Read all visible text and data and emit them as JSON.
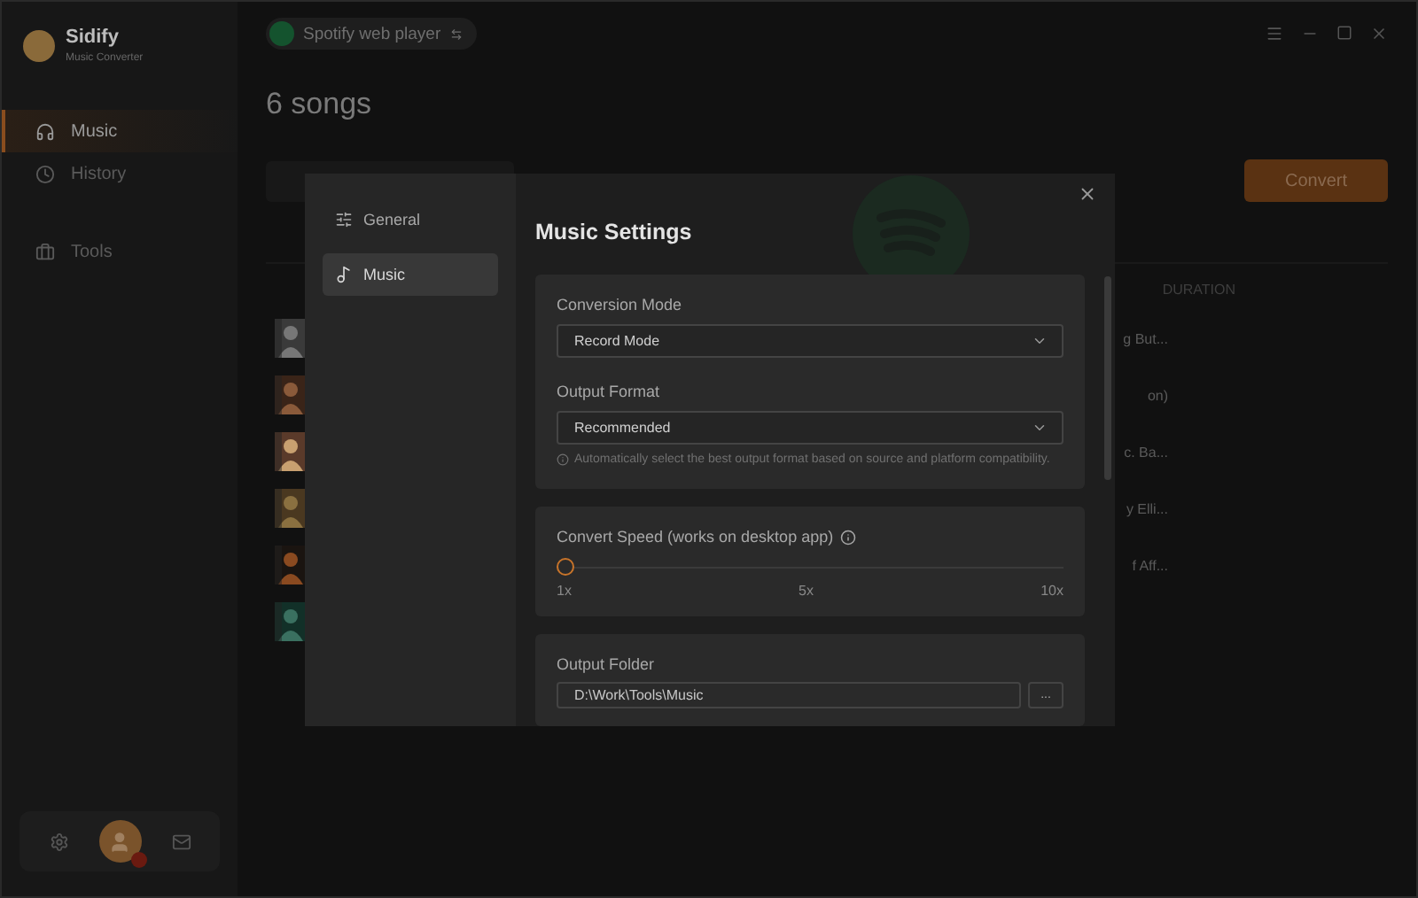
{
  "app": {
    "name": "Sidify",
    "subtitle": "Music Converter"
  },
  "sidebar": {
    "items": [
      {
        "label": "Music",
        "selected": true
      },
      {
        "label": "History",
        "selected": false
      },
      {
        "label": "Tools",
        "selected": false
      }
    ]
  },
  "source": {
    "label": "Spotify web player"
  },
  "page": {
    "title": "6 songs",
    "convert_button": "Convert",
    "duration_header": "DURATION"
  },
  "tracks": [
    {
      "kind": "picture",
      "title_tail": "g But..."
    },
    {
      "kind": "picture",
      "title_tail": "on)"
    },
    {
      "kind": "picture",
      "title_tail": "c. Ba..."
    },
    {
      "kind": "picture",
      "title_tail": "y Elli..."
    },
    {
      "kind": "picture",
      "title_tail": "f Aff..."
    },
    {
      "kind": "picture"
    }
  ],
  "dialog": {
    "nav": [
      {
        "label": "General",
        "selected": false
      },
      {
        "label": "Music",
        "selected": true
      }
    ],
    "title": "Music Settings",
    "conversion_mode": {
      "label": "Conversion Mode",
      "value": "Record Mode"
    },
    "output_format": {
      "label": "Output Format",
      "value": "Recommended",
      "hint": "Automatically select the best output format based on source and platform compatibility."
    },
    "convert_speed": {
      "label": "Convert Speed (works on desktop app)",
      "level": 0,
      "ticks": [
        "1x",
        "5x",
        "10x"
      ]
    },
    "output_folder": {
      "label": "Output Folder",
      "value": "D:\\Work\\Tools\\Music",
      "browse": "..."
    }
  }
}
